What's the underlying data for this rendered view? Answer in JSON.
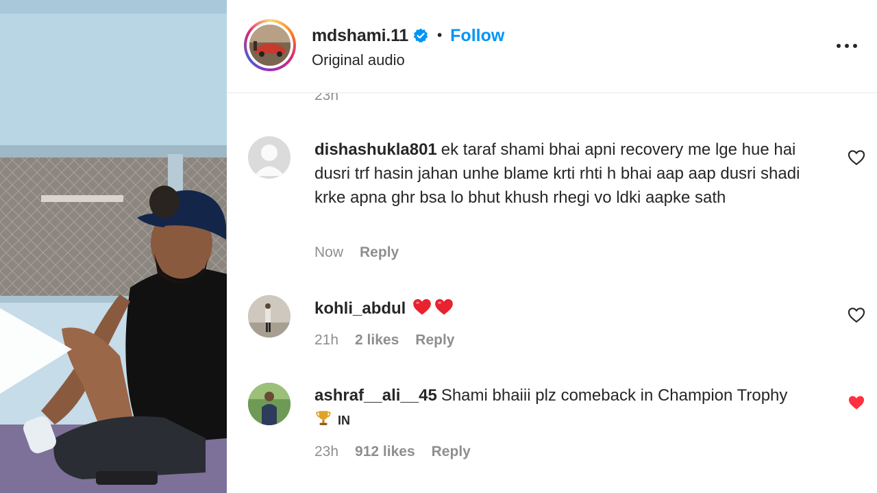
{
  "post": {
    "username": "mdshami.11",
    "separator": "•",
    "follow_label": "Follow",
    "audio_label": "Original audio",
    "more_icon": "more-horizontal-icon"
  },
  "previous_comment_time": "23h",
  "comments": [
    {
      "username": "dishashukla801",
      "text": "ek taraf shami bhai apni recovery me lge hue hai dusri trf hasin jahan unhe blame krti rhti h bhai aap aap dusri shadi krke apna ghr bsa lo bhut khush rhegi vo ldki aapke sath",
      "time": "Now",
      "likes": "",
      "reply_label": "Reply",
      "liked": false
    },
    {
      "username": "kohli_abdul",
      "text": "",
      "emoji": [
        "red-heart",
        "red-heart"
      ],
      "time": "21h",
      "likes": "2 likes",
      "reply_label": "Reply",
      "liked": false
    },
    {
      "username": "ashraf__ali__45",
      "text": "Shami bhaiii plz comeback in Champion Trophy",
      "trophy_emoji": "trophy",
      "flag_text": "IN",
      "time": "23h",
      "likes": "912 likes",
      "reply_label": "Reply",
      "liked": true
    }
  ],
  "colors": {
    "link_blue": "#0095f6",
    "verified_blue": "#0095f6",
    "liked_red": "#ff3040",
    "secondary_text": "#8e8e8e"
  }
}
